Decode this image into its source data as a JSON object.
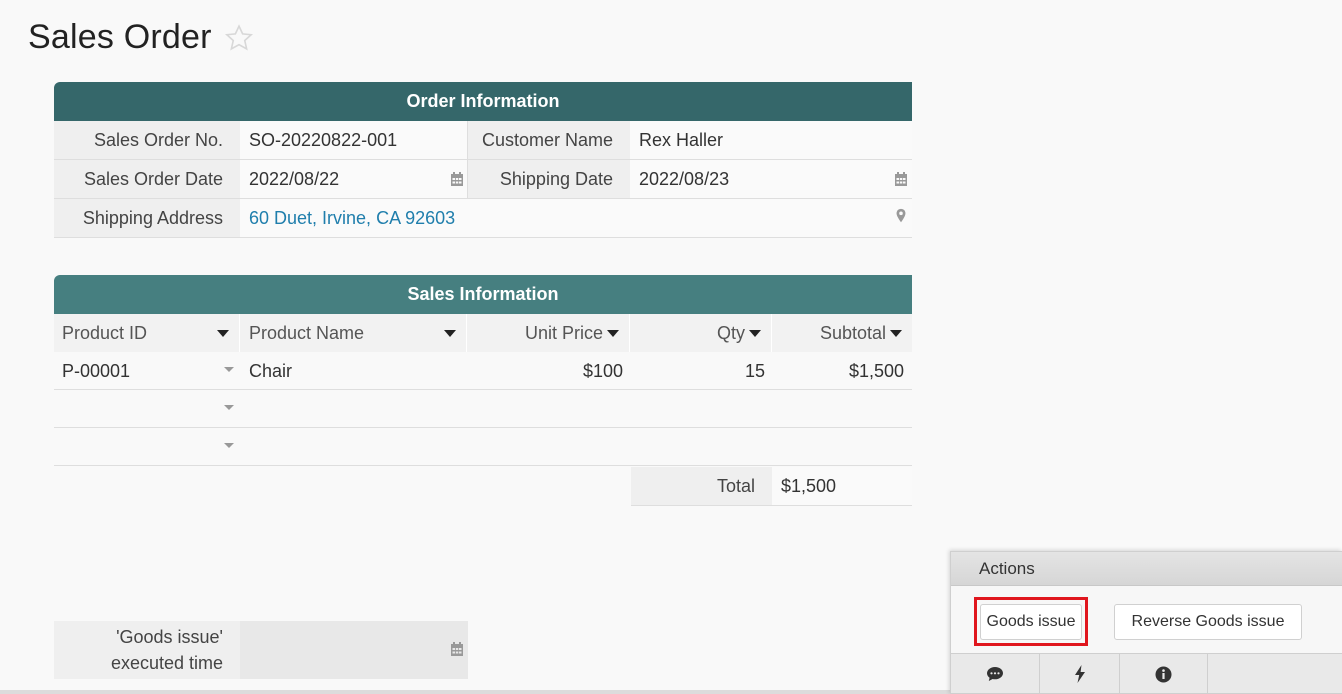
{
  "page": {
    "title": "Sales Order"
  },
  "order_info": {
    "header": "Order Information",
    "sales_order_no_label": "Sales Order No.",
    "sales_order_no": "SO-20220822-001",
    "customer_name_label": "Customer Name",
    "customer_name": "Rex Haller",
    "sales_order_date_label": "Sales Order Date",
    "sales_order_date": "2022/08/22",
    "shipping_date_label": "Shipping Date",
    "shipping_date": "2022/08/23",
    "shipping_address_label": "Shipping Address",
    "shipping_address": "60 Duet, Irvine, CA 92603"
  },
  "sales_info": {
    "header": "Sales Information",
    "columns": [
      "Product ID",
      "Product Name",
      "Unit Price",
      "Qty",
      "Subtotal"
    ],
    "rows": [
      {
        "product_id": "P-00001",
        "product_name": "Chair",
        "unit_price": "$100",
        "qty": "15",
        "subtotal": "$1,500"
      },
      {
        "product_id": "",
        "product_name": "",
        "unit_price": "",
        "qty": "",
        "subtotal": ""
      },
      {
        "product_id": "",
        "product_name": "",
        "unit_price": "",
        "qty": "",
        "subtotal": ""
      }
    ],
    "total_label": "Total",
    "total_value": "$1,500"
  },
  "goods_issue": {
    "label_line1": "'Goods issue'",
    "label_line2": "executed time",
    "value": ""
  },
  "actions": {
    "title": "Actions",
    "goods_issue_button": "Goods issue",
    "reverse_goods_issue_button": "Reverse Goods issue"
  },
  "colors": {
    "order_header_bg": "#35676a",
    "sales_header_bg": "#467f80",
    "link": "#1f7eac",
    "highlight": "#e0161e"
  },
  "icons": [
    "star-icon",
    "calendar-icon",
    "map-pin-icon",
    "comment-icon",
    "lightning-icon",
    "info-icon"
  ]
}
